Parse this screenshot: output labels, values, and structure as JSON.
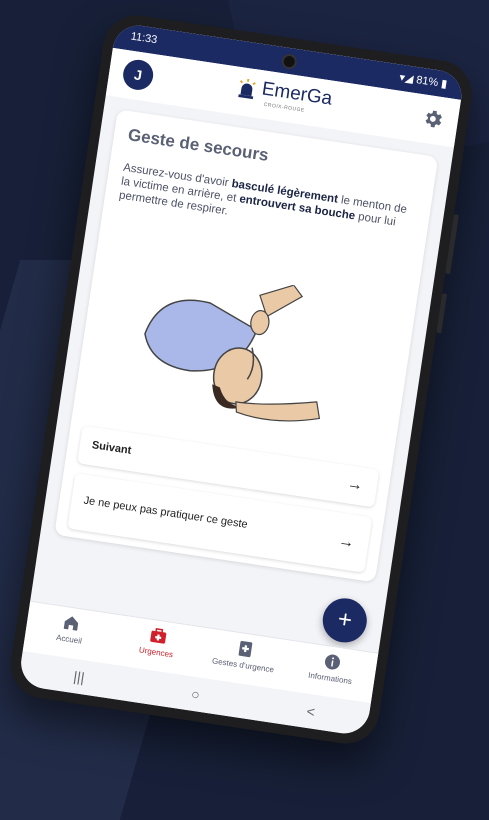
{
  "status": {
    "time": "11:33",
    "battery": "81%"
  },
  "header": {
    "avatar_initial": "J",
    "logo_text": "EmerGa",
    "logo_sub": "CROIX-ROUGE"
  },
  "card": {
    "title": "Geste de secours",
    "text_1": "Assurez-vous d'avoir ",
    "text_bold_1": "basculé légèrement",
    "text_2": " le menton de la victime en arrière, et ",
    "text_bold_2": "entrouvert sa bouche",
    "text_3": " pour lui permettre de respirer."
  },
  "actions": {
    "next_label": "Suivant",
    "next_arrow": "→",
    "cannot_label": "Je ne peux pas pratiquer ce geste",
    "cannot_arrow": "→"
  },
  "fab": {
    "label": "+"
  },
  "bottom_nav": [
    {
      "label": "Accueil",
      "icon": "home-icon"
    },
    {
      "label": "Urgences",
      "icon": "first-aid-kit-icon",
      "active": true
    },
    {
      "label": "Gestes d'urgence",
      "icon": "medical-book-icon"
    },
    {
      "label": "Informations",
      "icon": "info-icon"
    }
  ],
  "system_nav": {
    "recent": "|||",
    "home": "○",
    "back": "<"
  },
  "colors": {
    "primary": "#1b2a63",
    "accent": "#d0202b",
    "background": "#172038"
  }
}
